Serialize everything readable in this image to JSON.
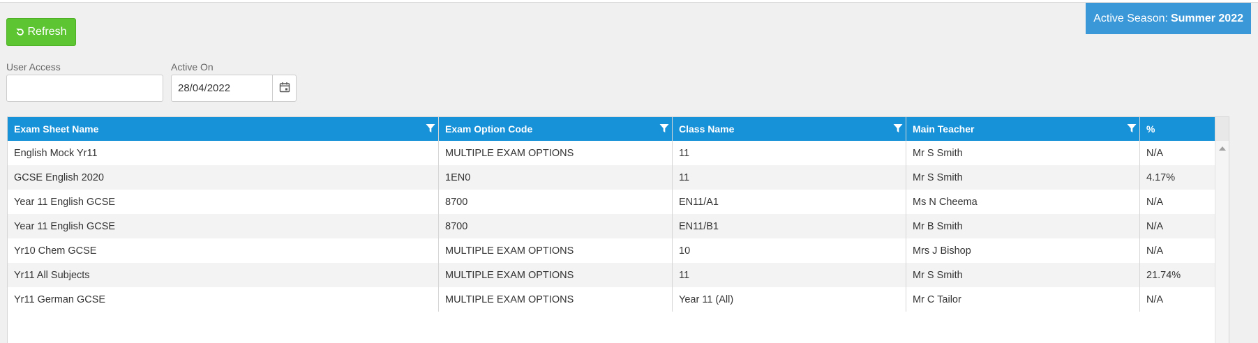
{
  "season": {
    "prefix": "Active Season:",
    "value": "Summer 2022",
    "color": "#3a98d8"
  },
  "toolbar": {
    "refresh_label": "Refresh",
    "refresh_icon": "refresh-icon",
    "refresh_color": "#5cc531"
  },
  "filters": {
    "user_access": {
      "label": "User Access",
      "value": "",
      "placeholder": ""
    },
    "active_on": {
      "label": "Active On",
      "value": "28/04/2022",
      "icon": "calendar-icon"
    }
  },
  "grid": {
    "header_color": "#1791d8",
    "columns": [
      {
        "label": "Exam Sheet Name",
        "filterable": true
      },
      {
        "label": "Exam Option Code",
        "filterable": true
      },
      {
        "label": "Class Name",
        "filterable": true
      },
      {
        "label": "Main Teacher",
        "filterable": true
      },
      {
        "label": "%",
        "filterable": false
      }
    ],
    "rows": [
      [
        "English Mock Yr11",
        "MULTIPLE EXAM OPTIONS",
        "11",
        "Mr S Smith",
        "N/A"
      ],
      [
        "GCSE English 2020",
        "1EN0",
        "11",
        "Mr S Smith",
        "4.17%"
      ],
      [
        "Year 11 English GCSE",
        "8700",
        "EN11/A1",
        "Ms N Cheema",
        "N/A"
      ],
      [
        "Year 11 English GCSE",
        "8700",
        "EN11/B1",
        "Mr B Smith",
        "N/A"
      ],
      [
        "Yr10 Chem GCSE",
        "MULTIPLE EXAM OPTIONS",
        "10",
        "Mrs J Bishop",
        "N/A"
      ],
      [
        "Yr11 All Subjects",
        "MULTIPLE EXAM OPTIONS",
        "11",
        "Mr S Smith",
        "21.74%"
      ],
      [
        "Yr11 German GCSE",
        "MULTIPLE EXAM OPTIONS",
        "Year 11 (All)",
        "Mr C Tailor",
        "N/A"
      ]
    ]
  }
}
